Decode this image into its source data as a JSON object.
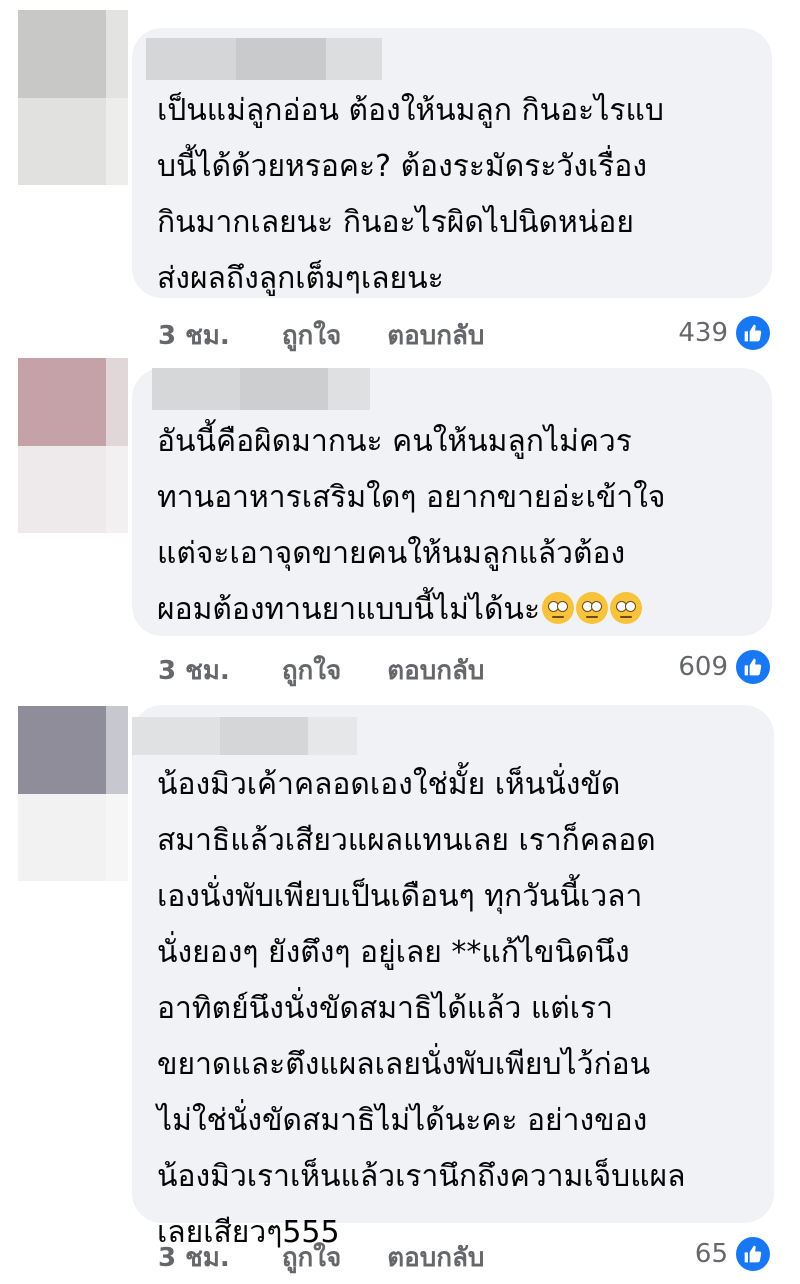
{
  "colors": {
    "bubble": "#f0f2f5",
    "meta_text": "#65676b",
    "like_badge": "#1877f2",
    "text": "#050505"
  },
  "comments": [
    {
      "text": "เป็นแม่ลูกอ่อน ต้องให้นมลูก กินอะไรแบ\nบนี้ได้ด้วยหรอคะ? ต้องระมัดระวังเรื่อง\nกินมากเลยนะ กินอะไรผิดไปนิดหน่อย\nส่งผลถึงลูกเต็มๆเลยนะ",
      "time": "3 ชม.",
      "like_label": "ถูกใจ",
      "reply_label": "ตอบกลับ",
      "reactions": "439",
      "reaction_icon": "thumbs-up-icon"
    },
    {
      "text": "อันนี้คือผิดมากนะ คนให้นมลูกไม่ควร\nทานอาหารเสริมใดๆ อยากขายอ่ะเข้าใจ\nแต่จะเอาจุดขายคนให้นมลูกแล้วต้อง\nผอมต้องทานยาแบบนี้ไม่ได้นะ",
      "emoji_count": 3,
      "emoji_icon": "face-with-rolling-eyes-icon",
      "time": "3 ชม.",
      "like_label": "ถูกใจ",
      "reply_label": "ตอบกลับ",
      "reactions": "609",
      "reaction_icon": "thumbs-up-icon"
    },
    {
      "text": "น้องมิวเค้าคลอดเองใช่มั้ย เห็นนั่งขัด\nสมาธิแล้วเสียวแผลแทนเลย เราก็คลอด\nเองนั่งพับเพียบเป็นเดือนๆ ทุกวันนี้เวลา\nนั่งยองๆ ยังตึงๆ อยู่เลย **แก้ไขนิดนึง\nอาทิตย์นึงนั่งขัดสมาธิได้แล้ว แต่เรา\nขยาดและตึงแผลเลยนั่งพับเพียบไว้ก่อน\nไม่ใช่นั่งขัดสมาธิไม่ได้นะคะ อย่างของ\nน้องมิวเราเห็นแล้วเรานึกถึงความเจ็บแผล\nเลยเสียวๆ555",
      "time": "3 ชม.",
      "like_label": "ถูกใจ",
      "reply_label": "ตอบกลับ",
      "reactions": "65",
      "reaction_icon": "thumbs-up-icon"
    }
  ]
}
